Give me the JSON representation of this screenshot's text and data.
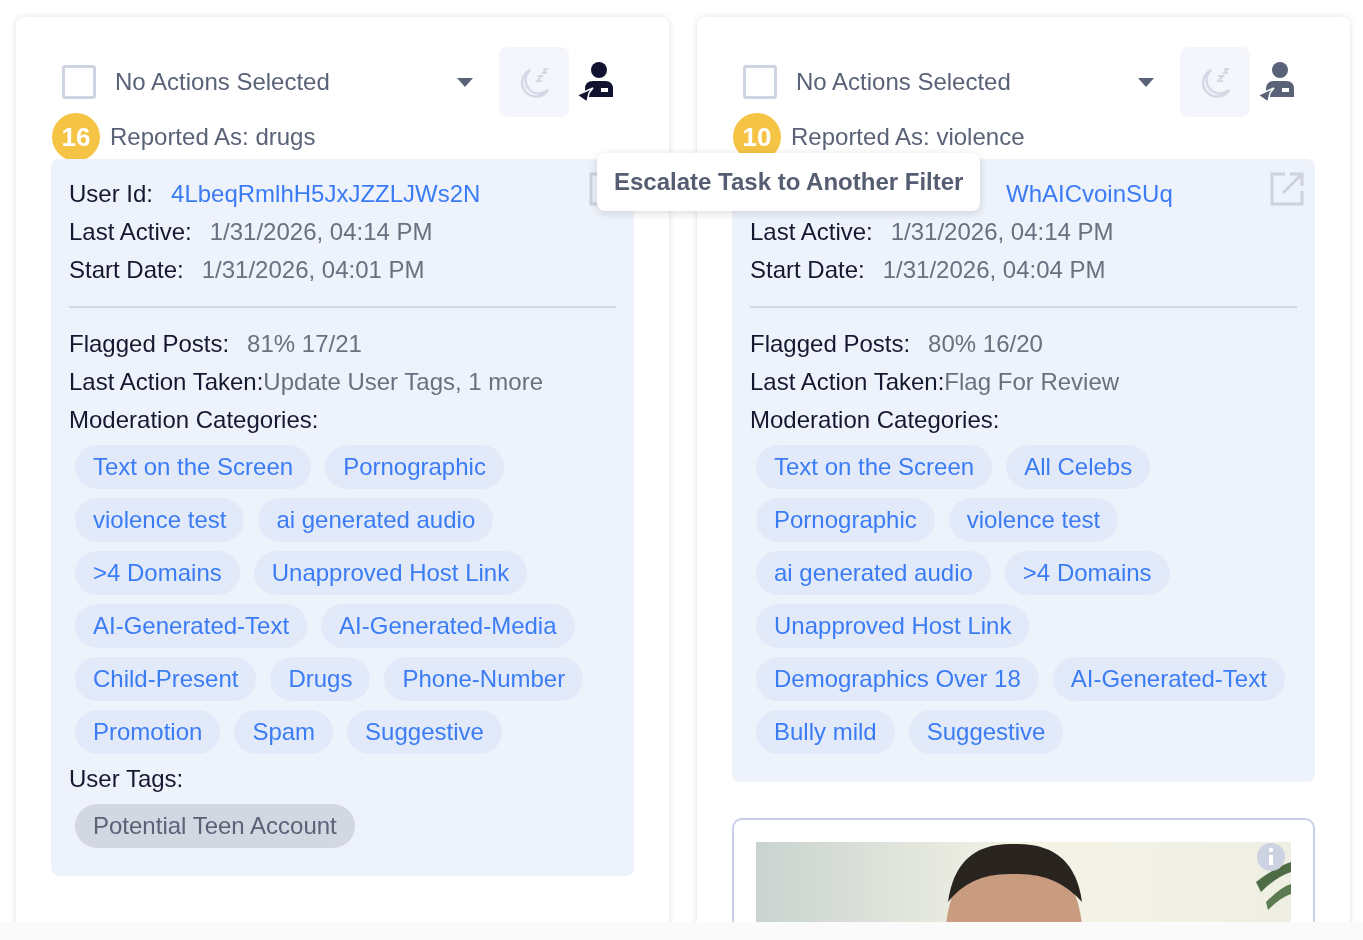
{
  "cards": [
    {
      "action_select": {
        "placeholder": "No Actions Selected",
        "checked": false
      },
      "escalate_highlighted": true,
      "count": "16",
      "reported_as": "Reported As: drugs",
      "user_id": {
        "label": "User Id:",
        "value": "4LbeqRmlhH5JxJZZLJWs2N"
      },
      "last_active": {
        "label": "Last Active:",
        "value": "1/31/2026, 04:14 PM"
      },
      "start_date": {
        "label": "Start Date:",
        "value": "1/31/2026, 04:01 PM"
      },
      "flagged_posts": {
        "label": "Flagged Posts:",
        "value": "81% 17/21"
      },
      "last_action": {
        "label": "Last Action Taken:",
        "value": "Update User Tags, 1 more"
      },
      "categories_label": "Moderation Categories:",
      "categories": [
        "Text on the Screen",
        "Pornographic",
        "violence test",
        "ai generated audio",
        ">4 Domains",
        "Unapproved Host Link",
        "AI-Generated-Text",
        "AI-Generated-Media",
        "Child-Present",
        "Drugs",
        "Phone-Number",
        "Promotion",
        "Spam",
        "Suggestive"
      ],
      "user_tags_label": "User Tags:",
      "user_tags": [
        "Potential Teen Account"
      ]
    },
    {
      "action_select": {
        "placeholder": "No Actions Selected",
        "checked": false
      },
      "escalate_highlighted": false,
      "count": "10",
      "reported_as": "Reported As: violence",
      "user_id": {
        "value": "WhAICvoinSUq"
      },
      "last_active": {
        "label": "Last Active:",
        "value": "1/31/2026, 04:14 PM"
      },
      "start_date": {
        "label": "Start Date:",
        "value": "1/31/2026, 04:04 PM"
      },
      "flagged_posts": {
        "label": "Flagged Posts:",
        "value": "80% 16/20"
      },
      "last_action": {
        "label": "Last Action Taken:",
        "value": "Flag For Review"
      },
      "categories_label": "Moderation Categories:",
      "categories": [
        "Text on the Screen",
        "All Celebs",
        "Pornographic",
        "violence test",
        "ai generated audio",
        ">4 Domains",
        "Unapproved Host Link",
        "Demographics Over 18",
        "AI-Generated-Text",
        "Bully mild",
        "Suggestive"
      ]
    }
  ],
  "tooltip": "Escalate Task to Another Filter"
}
